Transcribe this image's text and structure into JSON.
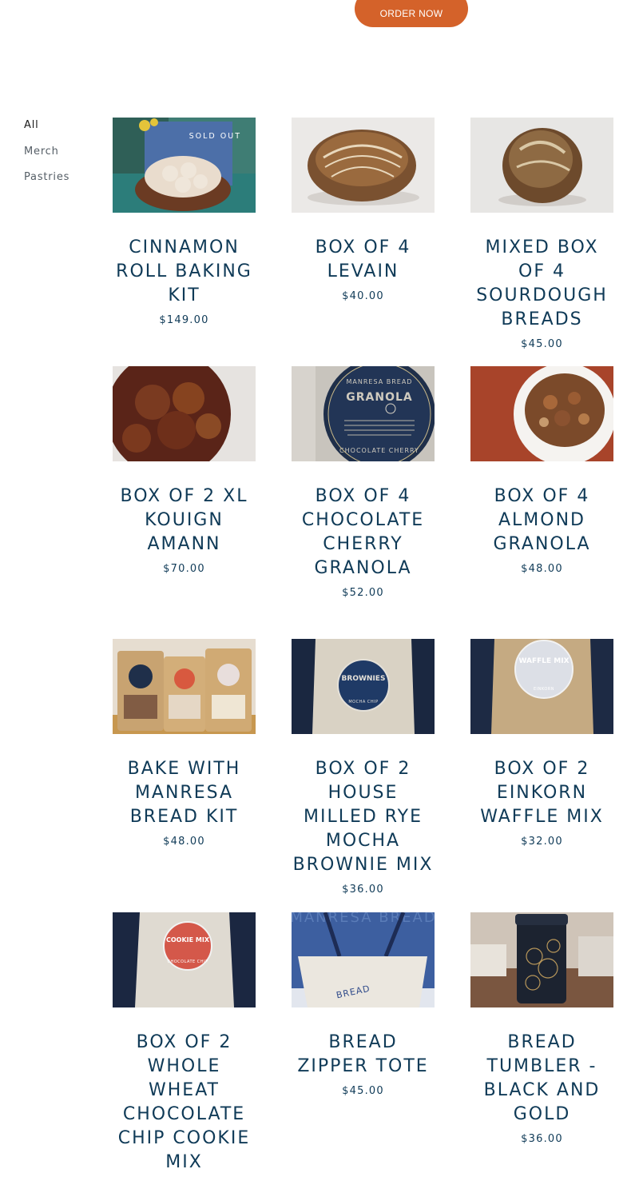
{
  "header": {
    "order_label": "ORDER NOW"
  },
  "sidebar": {
    "categories": [
      {
        "label": "All",
        "active": true
      },
      {
        "label": "Merch",
        "active": false
      },
      {
        "label": "Pastries",
        "active": false
      }
    ]
  },
  "products": [
    {
      "title": "CINNAMON ROLL BAKING KIT",
      "price": "$149.00",
      "badge": "SOLD OUT",
      "image": "cinnamon-roll-photo"
    },
    {
      "title": "BOX OF 4 LEVAIN",
      "price": "$40.00",
      "image": "levain-bread-photo"
    },
    {
      "title": "MIXED BOX OF 4 SOURDOUGH BREADS",
      "price": "$45.00",
      "image": "sourdough-bread-photo"
    },
    {
      "title": "BOX OF 2 XL KOUIGN AMANN",
      "price": "$70.00",
      "image": "kouign-amann-photo"
    },
    {
      "title": "BOX OF 4 CHOCOLATE CHERRY GRANOLA",
      "price": "$52.00",
      "image": "granola-bag-photo",
      "image_text": {
        "brand": "MANRESA BREAD",
        "name": "GRANOLA",
        "flavor": "CHOCOLATE CHERRY"
      }
    },
    {
      "title": "BOX OF 4 ALMOND GRANOLA",
      "price": "$48.00",
      "image": "granola-bowl-photo"
    },
    {
      "title": "BAKE WITH MANRESA BREAD KIT",
      "price": "$48.00",
      "image": "baking-mix-bags-photo"
    },
    {
      "title": "BOX OF 2 HOUSE MILLED RYE MOCHA BROWNIE MIX",
      "price": "$36.00",
      "image": "brownie-mix-photo",
      "image_text": {
        "name": "BROWNIES",
        "flavor": "MOCHA CHIP"
      }
    },
    {
      "title": "BOX OF 2 EINKORN WAFFLE MIX",
      "price": "$32.00",
      "image": "waffle-mix-photo",
      "image_text": {
        "name": "WAFFLE MIX",
        "flavor": "EINKORN"
      }
    },
    {
      "title": "BOX OF 2 WHOLE WHEAT CHOCOLATE CHIP COOKIE MIX",
      "price": "",
      "image": "cookie-mix-photo",
      "image_text": {
        "name": "COOKIE MIX",
        "flavor": "CHOCOLATE CHIP"
      }
    },
    {
      "title": "BREAD ZIPPER TOTE",
      "price": "$45.00",
      "image": "tote-bag-photo",
      "image_text": {
        "bag": "BREAD",
        "wall": "MANRESA BREAD"
      }
    },
    {
      "title": "BREAD TUMBLER - BLACK AND GOLD",
      "price": "$36.00",
      "image": "tumbler-photo"
    }
  ],
  "colors": {
    "accent": "#d4622a",
    "text": "#0f3a57",
    "background": "#ffffff"
  }
}
